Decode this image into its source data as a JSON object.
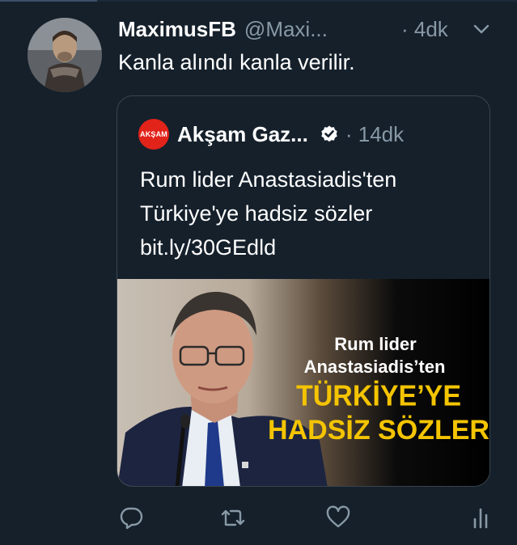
{
  "tweet": {
    "display_name": "MaximusFB",
    "handle": "@Maxi...",
    "time": "· 4dk",
    "text": "Kanla alındı kanla verilir."
  },
  "quoted": {
    "logo_text": "AKŞAM",
    "name": "Akşam Gaz...",
    "time": "· 14dk",
    "text_lines": [
      "Rum lider Anastasiadis'ten",
      "Türkiye'ye hadsiz sözler",
      "bit.ly/30GEdld"
    ],
    "image_caption": {
      "line1": "Rum lider",
      "line2": "Anastasiadis’ten",
      "line3": "TÜRKİYE’YE",
      "line4": "HADSİZ SÖZLER"
    }
  },
  "icons": {
    "reply": "reply-icon",
    "retweet": "retweet-icon",
    "like": "heart-icon",
    "stats": "analytics-icon",
    "menu": "chevron-down-icon",
    "verified": "verified-badge-icon"
  },
  "colors": {
    "background": "#15202b",
    "muted": "#8899a6",
    "border": "#38444d",
    "brand_red": "#e2231a",
    "caption_yellow": "#f4c400"
  }
}
